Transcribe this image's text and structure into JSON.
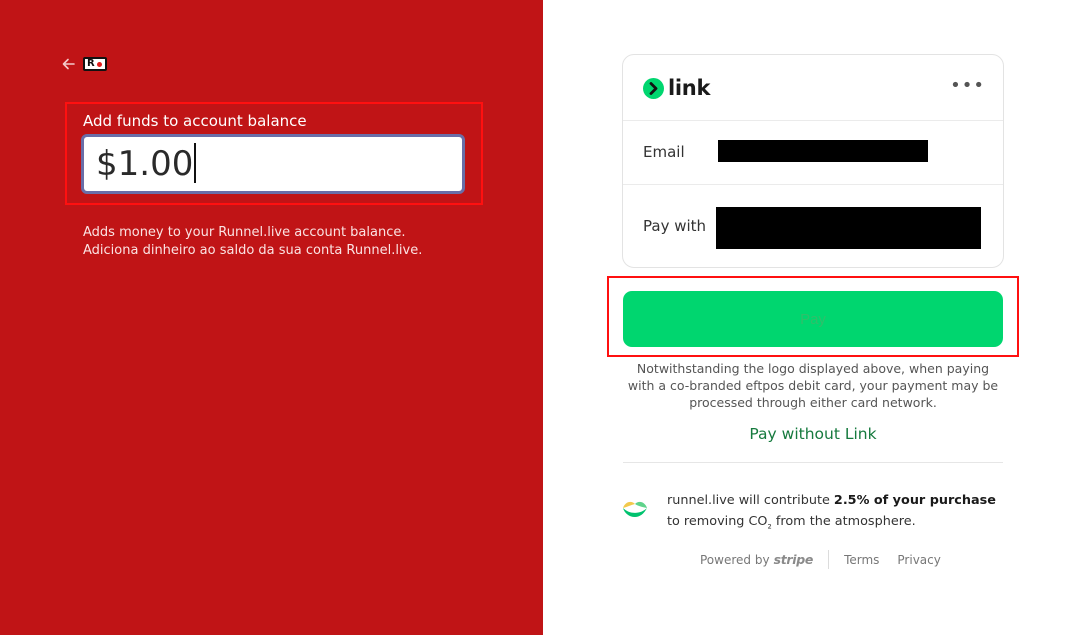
{
  "left": {
    "amount_label": "Add funds to account balance",
    "amount_value": "$1.00",
    "description_en": "Adds money to your Runnel.live account balance.",
    "description_pt": "Adiciona dinheiro ao saldo da sua conta Runnel.live."
  },
  "link_card": {
    "brand": "link",
    "more": "•••",
    "email_label": "Email",
    "pay_with_label": "Pay with"
  },
  "pay_button_label": "Pay",
  "notice": "Notwithstanding the logo displayed above, when paying with a co-branded eftpos debit card, your payment may be processed through either card network.",
  "pay_without_link": "Pay without Link",
  "climate": {
    "pre": "runnel.live will contribute ",
    "bold": "2.5% of your purchase",
    "post1": " to removing CO",
    "sub": "₂",
    "post2": " from the atmosphere."
  },
  "footer": {
    "powered_by": "Powered by",
    "stripe": "stripe",
    "terms": "Terms",
    "privacy": "Privacy"
  },
  "colors": {
    "left_bg": "#c01416",
    "link_green": "#00d66f",
    "pay_without_link": "#167a3e",
    "highlight_frame": "#ff1010"
  }
}
